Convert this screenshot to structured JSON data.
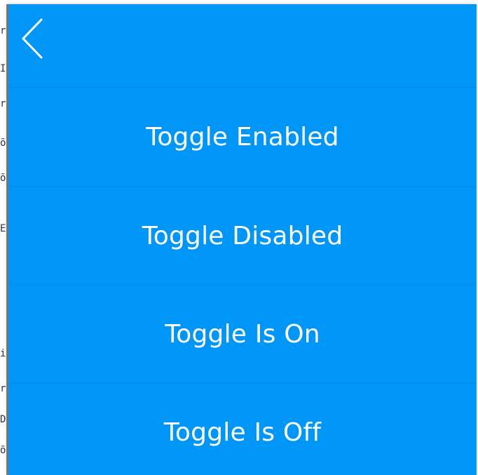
{
  "left_strip": {
    "glyphs": [
      "r",
      "I",
      "r",
      "õ",
      "õ",
      "E",
      "i",
      "r",
      "D",
      "õ"
    ]
  },
  "header": {
    "back_icon": "chevron-left-icon"
  },
  "menu": {
    "items": [
      {
        "label": "Toggle Enabled"
      },
      {
        "label": "Toggle Disabled"
      },
      {
        "label": "Toggle Is On"
      },
      {
        "label": "Toggle Is Off"
      }
    ]
  },
  "colors": {
    "panel_background": "#0096f7",
    "text": "#ffffff",
    "back_icon": "#ffffff"
  }
}
